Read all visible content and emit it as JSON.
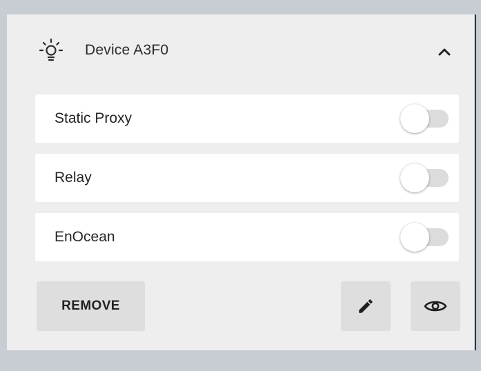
{
  "device": {
    "title": "Device A3F0",
    "icon": "lightbulb-icon",
    "collapse_icon": "chevron-up-icon"
  },
  "features": [
    {
      "label": "Static Proxy",
      "enabled": false
    },
    {
      "label": "Relay",
      "enabled": false
    },
    {
      "label": "EnOcean",
      "enabled": false
    }
  ],
  "actions": {
    "remove_label": "REMOVE",
    "edit_icon": "pencil-icon",
    "view_icon": "eye-icon"
  },
  "colors": {
    "background": "#c8ccd3",
    "panel": "#eeeeee",
    "row": "#ffffff",
    "button": "#dedede",
    "text": "#262626"
  }
}
